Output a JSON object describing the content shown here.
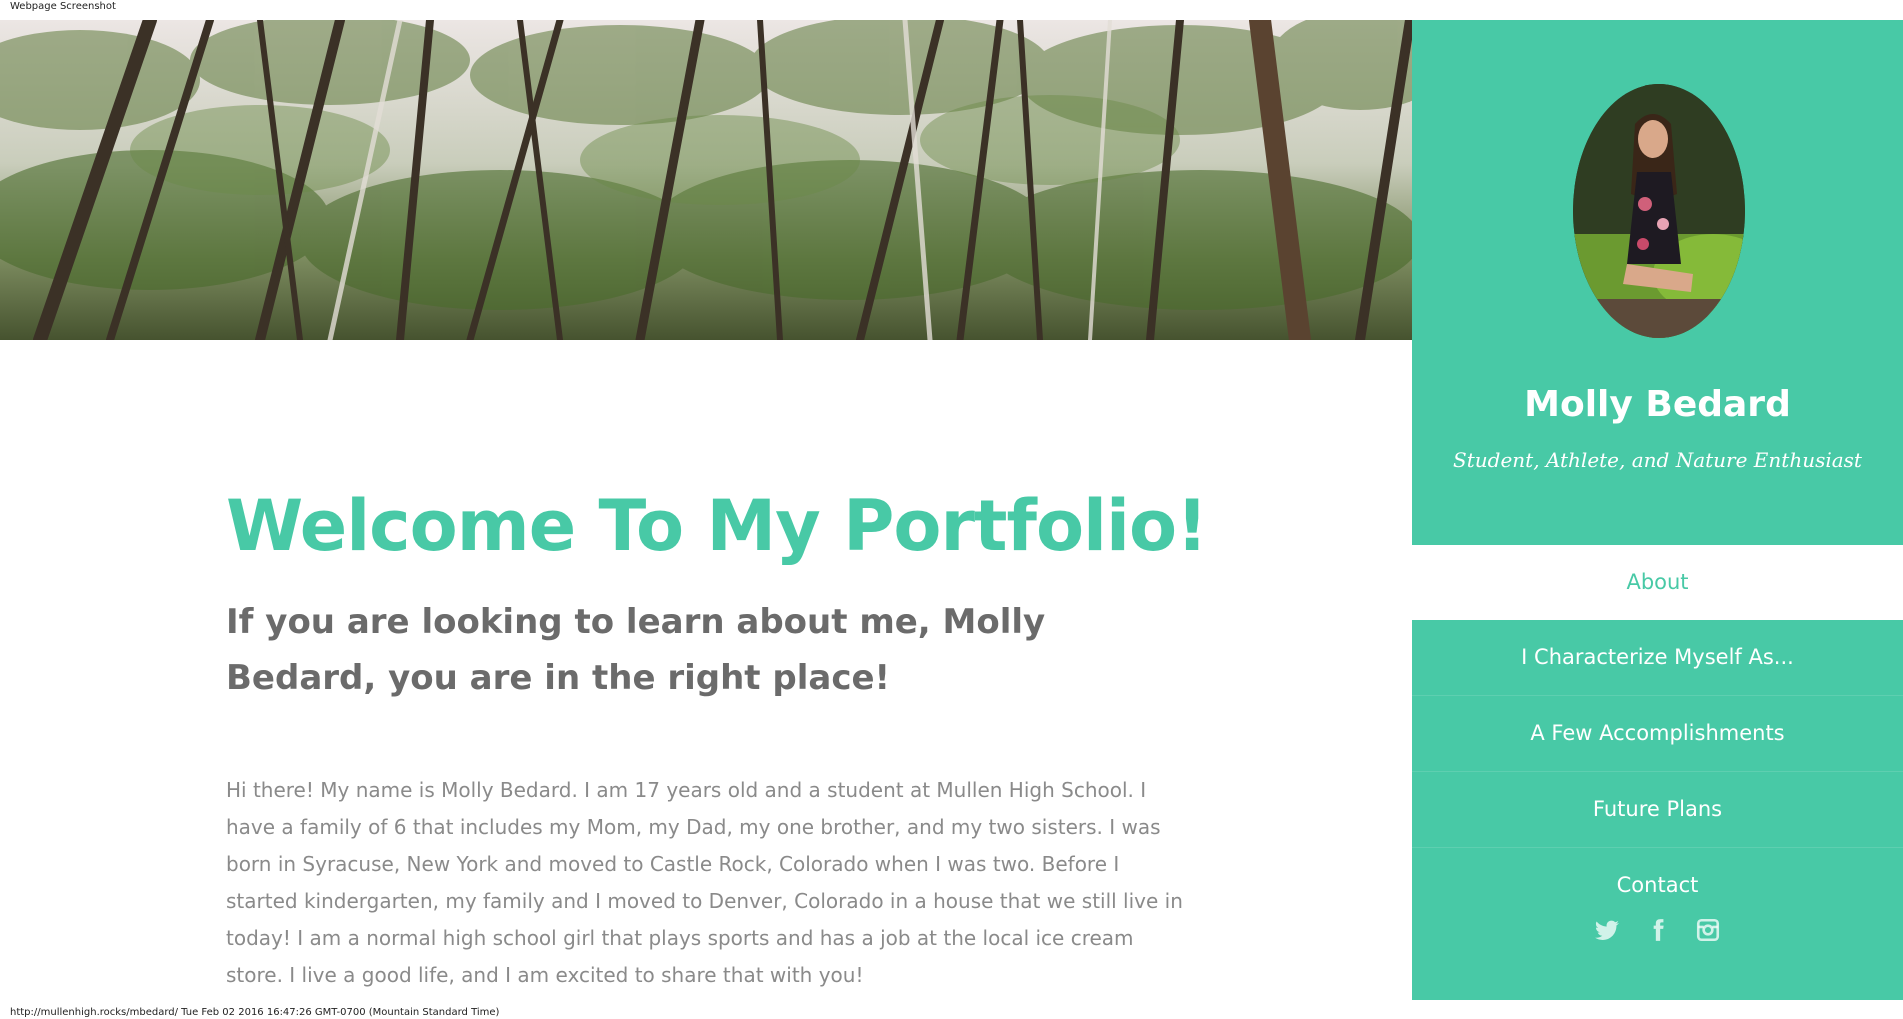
{
  "captions": {
    "top": "Webpage Screenshot",
    "bottom": "http://mullenhigh.rocks/mbedard/ Tue Feb 02 2016 16:47:26 GMT-0700 (Mountain Standard Time)"
  },
  "main": {
    "heading": "Welcome To My Portfolio!",
    "subheading": "If you are looking to learn about me, Molly Bedard, you are in the right place!",
    "intro": "Hi there! My name is Molly Bedard. I am 17 years old and a student at Mullen High School. I have a family of 6 that includes my Mom, my Dad, my one brother, and my two sisters. I was born in Syracuse, New York and moved to Castle Rock, Colorado when I was two. Before I started kindergarten, my family and I moved to Denver, Colorado in a house that we still live in today! I am a normal high school girl that plays sports and has a job at the local ice cream store. I live a good life, and I am excited to share that with you!"
  },
  "sidebar": {
    "name": "Molly Bedard",
    "tagline": "Student, Athlete, and Nature Enthusiast",
    "nav": [
      {
        "label": "About",
        "active": true
      },
      {
        "label": "I Characterize Myself As..."
      },
      {
        "label": "A Few Accomplishments"
      },
      {
        "label": "Future Plans"
      },
      {
        "label": "Contact"
      }
    ],
    "social": [
      "twitter-icon",
      "facebook-icon",
      "instagram-icon"
    ]
  },
  "colors": {
    "accent": "#48c9a6",
    "heading_gray": "#6b6b6b",
    "body_gray": "#8a8a8a"
  }
}
